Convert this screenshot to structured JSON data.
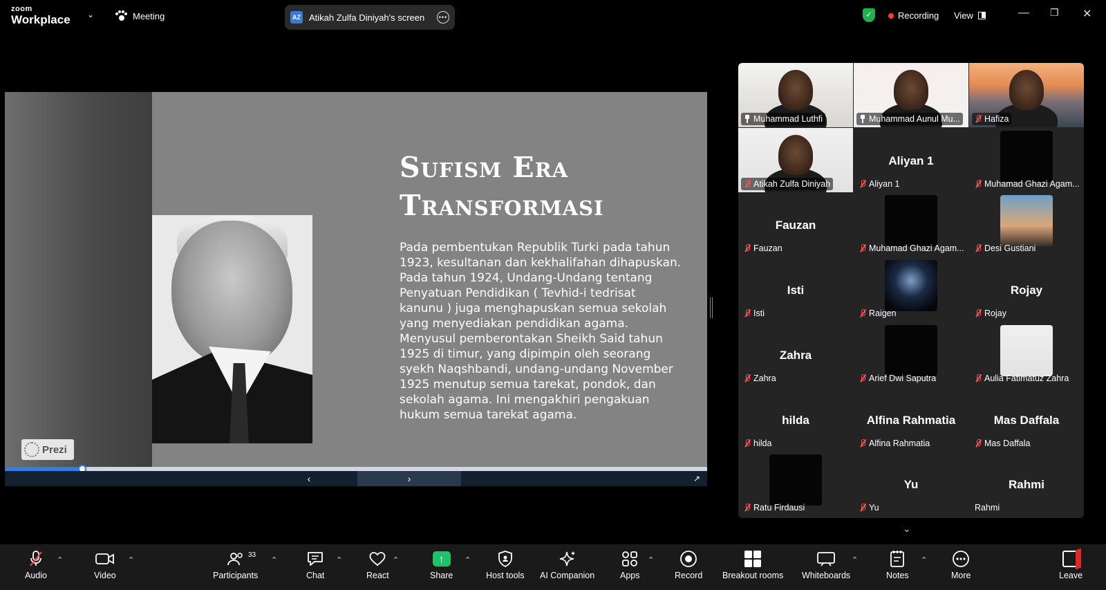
{
  "topbar": {
    "logo_line1": "zoom",
    "logo_line2": "Workplace",
    "meeting_label": "Meeting",
    "screen_initials": "AZ",
    "screen_title": "Atikah Zulfa Diniyah's screen",
    "recording_label": "Recording",
    "view_label": "View",
    "colors": {
      "security_shield": "#1fb14b",
      "recording_dot": "#ff3b3b"
    }
  },
  "slide": {
    "title_line1": "Sufism Era",
    "title_line2": "Transformasi",
    "body": "Pada pembentukan Republik Turki pada tahun 1923, kesultanan dan kekhalifahan dihapuskan. Pada tahun 1924, Undang-Undang tentang Penyatuan Pendidikan ( Tevhid-i tedrisat kanunu ) juga menghapuskan semua sekolah yang menyediakan pendidikan agama. Menyusul pemberontakan Sheikh Said tahun 1925 di timur, yang dipimpin oleh seorang syekh Naqshbandi, undang-undang November 1925 menutup semua tarekat, pondok, dan sekolah agama. Ini mengakhiri pengakuan hukum semua tarekat agama.",
    "watermark": "Prezi",
    "progress_fraction": 0.11,
    "prev_icon": "chevron-left-icon",
    "next_icon": "chevron-right-icon",
    "fullscreen_icon": "fullscreen-icon"
  },
  "gallery": {
    "tiles": [
      {
        "name": "Muhammad Luthfi",
        "type": "video",
        "video": "vid-room",
        "badge": "pin"
      },
      {
        "name": "Muhammad Aunul Mu...",
        "type": "video",
        "video": "vid-red",
        "badge": "pin",
        "active": true
      },
      {
        "name": "Hafiza",
        "type": "video",
        "video": "vid-bridge",
        "badge": "mic-off"
      },
      {
        "name": "Atikah Zulfa Diniyah",
        "type": "video",
        "video": "vid-white",
        "badge": "mic-off"
      },
      {
        "name": "Aliyan 1",
        "type": "name",
        "big": "Aliyan 1",
        "badge": "mic-off"
      },
      {
        "name": "Muhamad Ghazi Agam...",
        "type": "thumb",
        "thumb": "dark-thumb",
        "badge": "mic-off"
      },
      {
        "name": "Fauzan",
        "type": "name",
        "big": "Fauzan",
        "badge": "mic-off"
      },
      {
        "name": "Muhamad Ghazi Agam...",
        "type": "thumb",
        "thumb": "dark-thumb",
        "badge": "mic-off"
      },
      {
        "name": "Desi Gustiani",
        "type": "thumb",
        "thumb": "sky-thumb",
        "badge": "mic-off"
      },
      {
        "name": "Isti",
        "type": "name",
        "big": "Isti",
        "badge": "mic-off"
      },
      {
        "name": "Raigen",
        "type": "thumb",
        "thumb": "night-thumb",
        "badge": "mic-off"
      },
      {
        "name": "Rojay",
        "type": "name",
        "big": "Rojay",
        "badge": "mic-off"
      },
      {
        "name": "Zahra",
        "type": "name",
        "big": "Zahra",
        "badge": "mic-off"
      },
      {
        "name": "Arief Dwi Saputra",
        "type": "thumb",
        "thumb": "dark-thumb",
        "badge": "mic-off"
      },
      {
        "name": "Aulia Fatimatuz Zahra",
        "type": "thumb",
        "thumb": "vid-white",
        "badge": "mic-off"
      },
      {
        "name": "hilda",
        "type": "name",
        "big": "hilda",
        "badge": "mic-off"
      },
      {
        "name": "Alfina Rahmatia",
        "type": "name",
        "big": "Alfina Rahmatia",
        "badge": "mic-off"
      },
      {
        "name": "Mas Daffala",
        "type": "name",
        "big": "Mas Daffala",
        "badge": "mic-off"
      },
      {
        "name": "Ratu Firdausi",
        "type": "thumb",
        "thumb": "dark-thumb",
        "badge": "mic-off"
      },
      {
        "name": "Yu",
        "type": "name",
        "big": "Yu",
        "badge": "mic-off"
      },
      {
        "name": "Rahmi",
        "type": "name",
        "big": "Rahmi",
        "badge": "none"
      }
    ]
  },
  "toolbar": {
    "audio": "Audio",
    "video": "Video",
    "participants": "Participants",
    "participants_count": "33",
    "chat": "Chat",
    "react": "React",
    "share": "Share",
    "host_tools": "Host tools",
    "ai_companion": "AI Companion",
    "apps": "Apps",
    "record": "Record",
    "breakout_rooms": "Breakout rooms",
    "whiteboards": "Whiteboards",
    "notes": "Notes",
    "more": "More",
    "leave": "Leave",
    "colors": {
      "share_green": "#21c16b",
      "leave_red": "#e02828"
    }
  }
}
